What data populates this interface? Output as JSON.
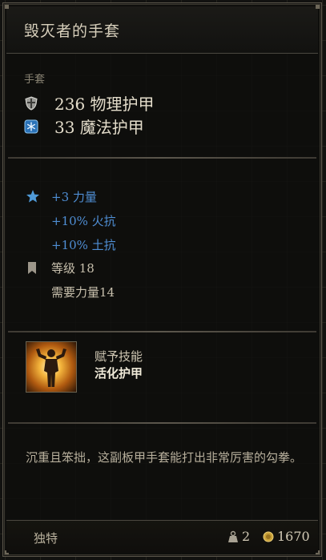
{
  "item": {
    "name": "毁灭者的手套",
    "category": "手套",
    "armor": [
      {
        "icon": "shield-icon",
        "text": "236 物理护甲"
      },
      {
        "icon": "snowflake-icon",
        "text": "33 魔法护甲"
      }
    ],
    "bonuses": [
      {
        "text": "+3 力量",
        "color": "#4f8ed4"
      },
      {
        "text": "+10% 火抗",
        "color": "#4f8ed4"
      },
      {
        "text": "+10% 土抗",
        "color": "#4f8ed4"
      }
    ],
    "level": "等级 18",
    "requirement": "需要力量14",
    "skill": {
      "heading": "赋予技能",
      "name": "活化护甲",
      "icon": "flexing-figure-icon"
    },
    "description": "沉重且笨拙，这副板甲手套能打出非常厉害的勾拳。",
    "rarity": "独特",
    "weight": "2",
    "value": "1670"
  },
  "colors": {
    "accent_blue": "#4f8ed4",
    "gold": "#c9a23a",
    "text_light": "#e4ddcb"
  }
}
